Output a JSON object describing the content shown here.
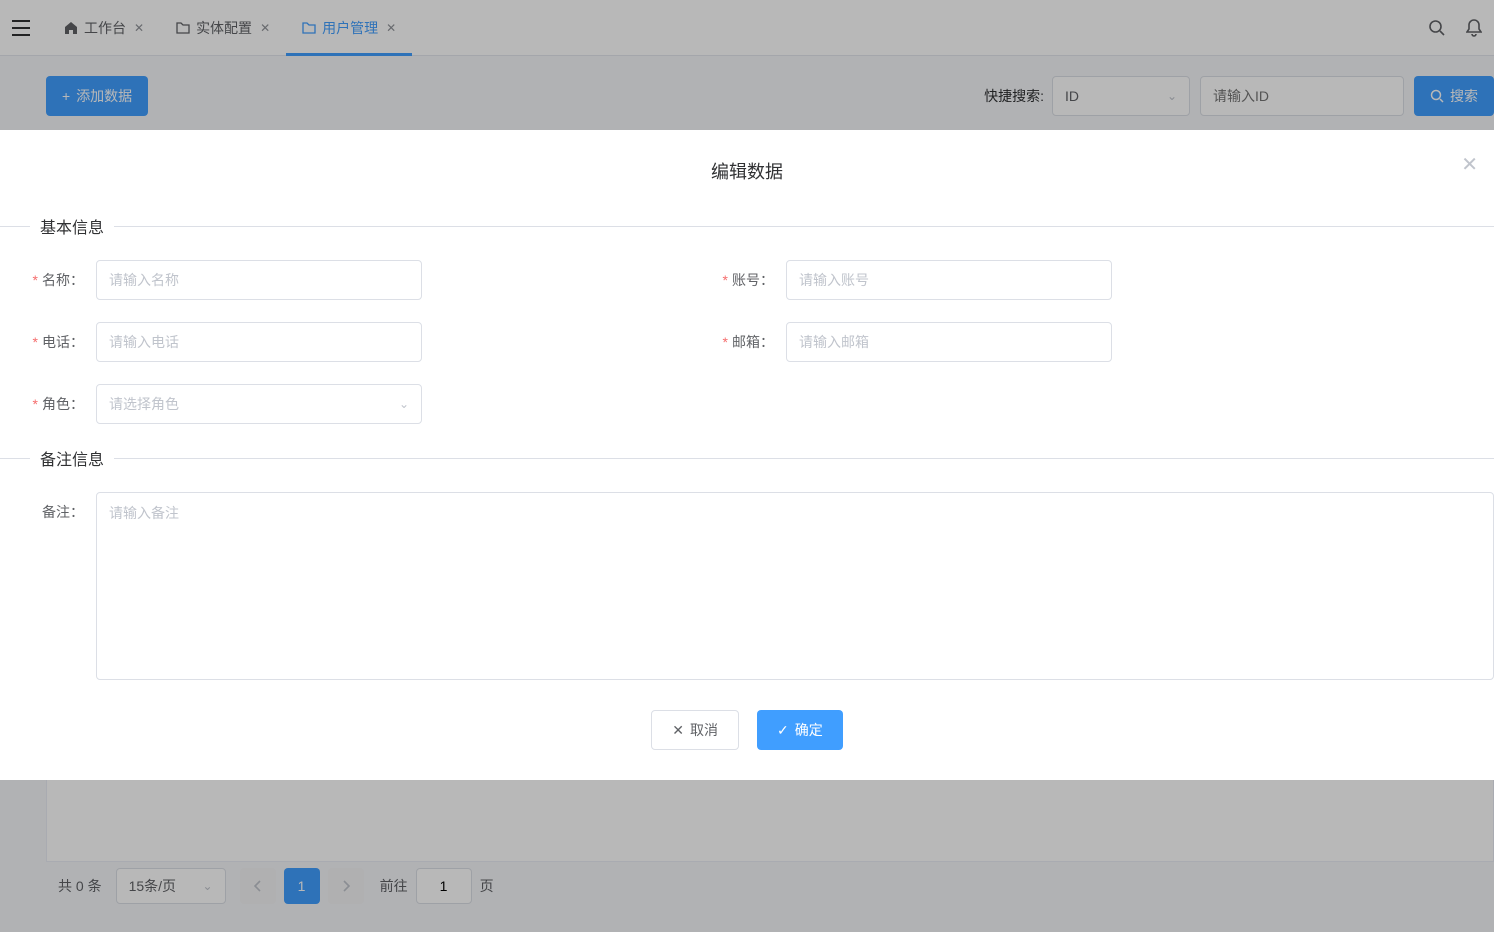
{
  "tabs": [
    {
      "label": "工作台",
      "icon": "home"
    },
    {
      "label": "实体配置",
      "icon": "folder"
    },
    {
      "label": "用户管理",
      "icon": "folder",
      "active": true
    }
  ],
  "toolbar": {
    "add_label": "添加数据",
    "search_label": "快捷搜索:",
    "search_field_selected": "ID",
    "search_placeholder": "请输入ID",
    "search_btn": "搜索"
  },
  "pagination": {
    "total_prefix": "共",
    "total_count": "0",
    "total_suffix": "条",
    "page_size": "15条/页",
    "current_page": "1",
    "goto_label": "前往",
    "goto_value": "1",
    "page_suffix": "页"
  },
  "modal": {
    "title": "编辑数据",
    "section_basic": "基本信息",
    "section_remark": "备注信息",
    "fields": {
      "name_label": "名称：",
      "name_placeholder": "请输入名称",
      "account_label": "账号：",
      "account_placeholder": "请输入账号",
      "phone_label": "电话：",
      "phone_placeholder": "请输入电话",
      "email_label": "邮箱：",
      "email_placeholder": "请输入邮箱",
      "role_label": "角色：",
      "role_placeholder": "请选择角色",
      "remark_label": "备注：",
      "remark_placeholder": "请输入备注"
    },
    "cancel": "取消",
    "confirm": "确定"
  }
}
